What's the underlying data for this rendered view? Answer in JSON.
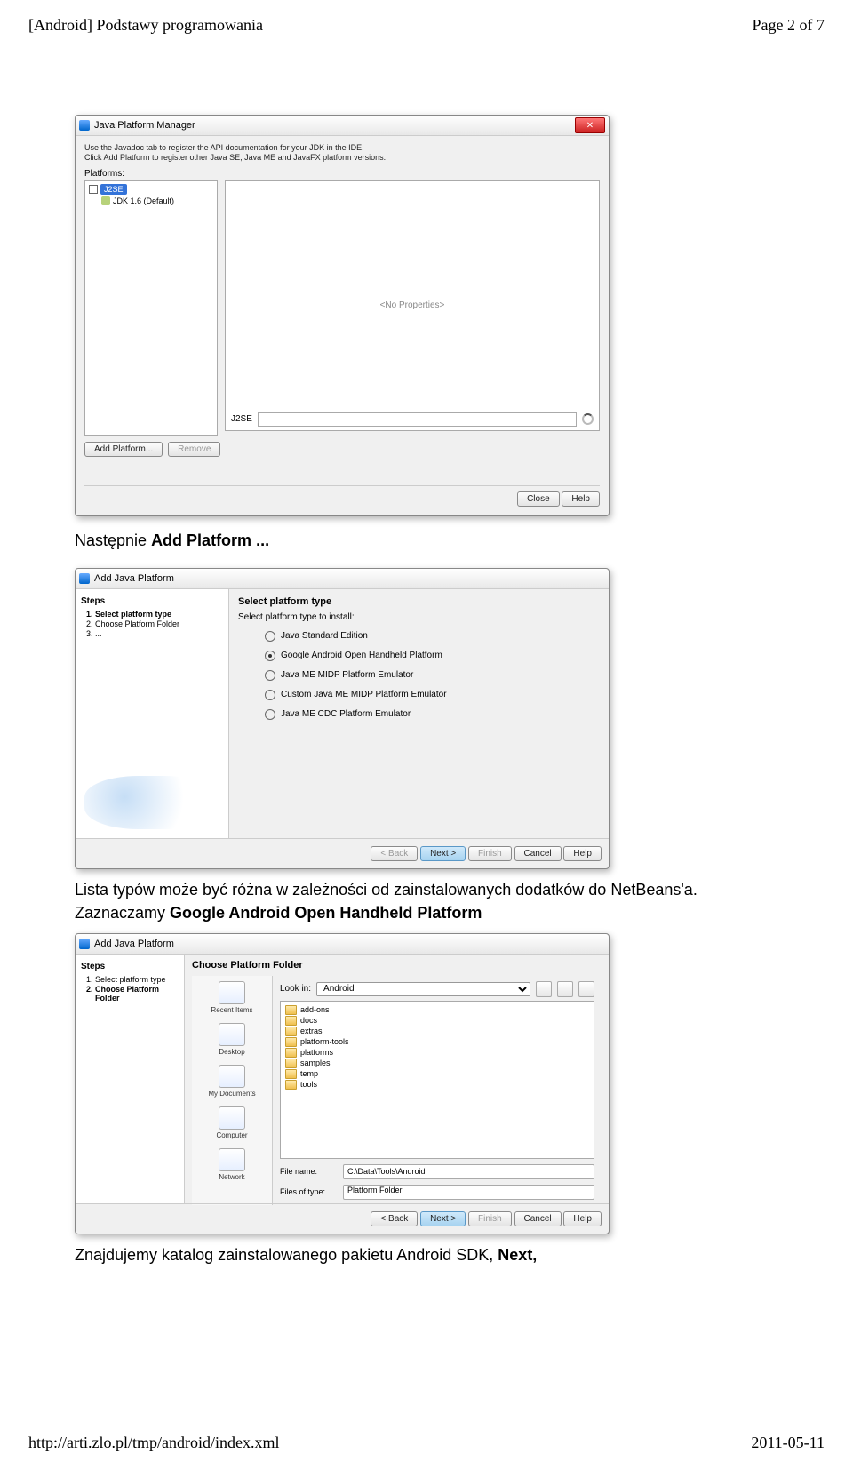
{
  "header": {
    "title": "[Android] Podstawy programowania",
    "pager": "Page 2 of 7"
  },
  "footer": {
    "url": "http://arti.zlo.pl/tmp/android/index.xml",
    "date": "2011-05-11"
  },
  "text": {
    "p1_a": "Następnie ",
    "p1_b": "Add Platform ...",
    "p2_a": "Lista typów może być różna w zależności od zainstalowanych dodatków do NetBeans'a. Zaznaczamy ",
    "p2_b": "Google Android Open Handheld Platform",
    "p3_a": "Znajdujemy katalog zainstalowanego pakietu Android SDK, ",
    "p3_b": "Next,"
  },
  "jpm": {
    "title": "Java Platform Manager",
    "hint1": "Use the Javadoc tab to register the API documentation for your JDK in the IDE.",
    "hint2": "Click Add Platform to register other Java SE, Java ME and JavaFX platform versions.",
    "platforms_label": "Platforms:",
    "tree_root": "J2SE",
    "tree_child": "JDK 1.6 (Default)",
    "no_prop": "<No Properties>",
    "name_label": "J2SE",
    "add_btn": "Add Platform...",
    "remove_btn": "Remove",
    "close_btn": "Close",
    "help_btn": "Help"
  },
  "ajp": {
    "title": "Add Java Platform",
    "steps_h": "Steps",
    "steps": [
      "Select platform type",
      "Choose Platform Folder",
      "..."
    ],
    "heading": "Select platform type",
    "subtitle": "Select platform type to install:",
    "opts": [
      "Java Standard Edition",
      "Google Android Open Handheld Platform",
      "Java ME MIDP Platform Emulator",
      "Custom Java ME MIDP Platform Emulator",
      "Java ME CDC Platform Emulator"
    ],
    "back": "< Back",
    "next": "Next >",
    "finish": "Finish",
    "cancel": "Cancel",
    "help": "Help"
  },
  "ajp3": {
    "title": "Add Java Platform",
    "steps_h": "Steps",
    "steps": [
      "Select platform type",
      "Choose Platform Folder"
    ],
    "heading": "Choose Platform Folder",
    "lookin": "Look in:",
    "lookin_val": "Android",
    "folders": [
      "add-ons",
      "docs",
      "extras",
      "platform-tools",
      "platforms",
      "samples",
      "temp",
      "tools"
    ],
    "places": [
      "Recent Items",
      "Desktop",
      "My Documents",
      "Computer",
      "Network"
    ],
    "filename_label": "File name:",
    "filename_val": "C:\\Data\\Tools\\Android",
    "filetype_label": "Files of type:",
    "filetype_val": "Platform Folder",
    "back": "< Back",
    "next": "Next >",
    "finish": "Finish",
    "cancel": "Cancel",
    "help": "Help"
  }
}
